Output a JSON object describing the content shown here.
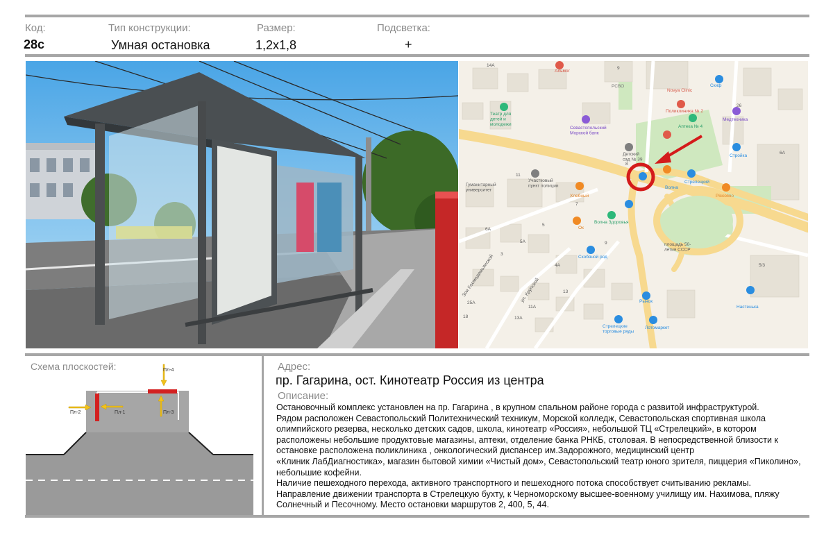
{
  "header": {
    "code_label": "Код:",
    "code_value": "28с",
    "type_label": "Тип конструкции:",
    "type_value": "Умная остановка",
    "size_label": "Размер:",
    "size_value": "1,2х1,8",
    "light_label": "Подсветка:",
    "light_value": "+"
  },
  "map": {
    "labels": {
      "l14a": "14А",
      "almog": "Альмог",
      "rsvo": "РСВО",
      "l9": "9",
      "novya": "Novya Clinic",
      "skif": "Скиф",
      "teatr": "Театр для\nдетей и\nмолодежи",
      "bank": "Севастопольский\nМорской банк",
      "poli": "Поликлиника № 2",
      "apteka": "Аптека № 4",
      "l26": "26",
      "medt": "Медтехника",
      "detsad": "Детский\nсад № 39",
      "stroyka": "Стройка",
      "l6a": "6А",
      "gumun": "Гуманитарный\nуниверситет",
      "l11": "11",
      "uchastok": "Участковый\nпункт полиции",
      "l8": "8",
      "hlebny": "Хлебный",
      "volna": "Волна",
      "strel": "Стрелецкий",
      "picco": "Piccolino",
      "l6a2": "6А",
      "l7": "7",
      "l5": "5",
      "volna_zd": "Волна Здоровья",
      "ok": "Ок",
      "skor": "Скобяной ряд",
      "ploshad": "площадь 50-\nлетия СССР",
      "l4a": "4А",
      "l5a": "5А",
      "l3": "3",
      "l9b": "9",
      "kosmo": "Зои Космодемьянской",
      "krup": "ул. Крупской",
      "l25a": "25А",
      "l18": "18",
      "l13a": "13А",
      "l11a": "11А",
      "l13": "13",
      "rynok": "Рынок",
      "nasten": "Настенька",
      "strel_torg": "Стрелецкие\nторговые ряды",
      "loto": "Лотомаркет",
      "l5_3": "5/3"
    }
  },
  "scheme": {
    "title": "Схема плоскостей:",
    "p1": "Пл-1",
    "p2": "Пл-2",
    "p3": "Пл-3",
    "p4": "Пл-4",
    "colors": {
      "panel": "#d32020",
      "arrow": "#f2c21b",
      "road": "#9a9a9a"
    }
  },
  "info": {
    "address_label": "Адрес:",
    "address": "пр. Гагарина, ост. Кинотеатр Россия из центра",
    "desc_label": "Описание:",
    "description": "Остановочный комплекс установлен на пр. Гагарина , в крупном спальном районе города  с развитой инфраструктурой.\nРядом расположен Севастопольский Политехнический техникум,  Морской колледж,  Севастопольская спортивная школа олимпийского резерва,  несколько детских садов, школа, кинотеатр «Россия», небольшой  ТЦ «Стрелецкий», в котором расположены небольшие продуктовые магазины, аптеки, отделение банка РНКБ, столовая. В непосредственной близости к остановке расположена поликлиника , онкологический диспансер им.Задорожного, медицинский центр\n«Клиник ЛабДиагностика», магазин бытовой химии «Чистый дом»,  Севастопольский театр юного зрителя, пиццерия «Пиколино», небольшие кофейни.\n Наличие пешеходного перехода, активного транспортного и пешеходного потока способствует    считыванию рекламы.\nНаправление движении транспорта в Стрелецкую бухту, к  Черноморскому высшее-военному училищу им. Нахимова, пляжу Солнечный и Песочному.  Место остановки маршрутов 2, 400, 5, 44."
  }
}
